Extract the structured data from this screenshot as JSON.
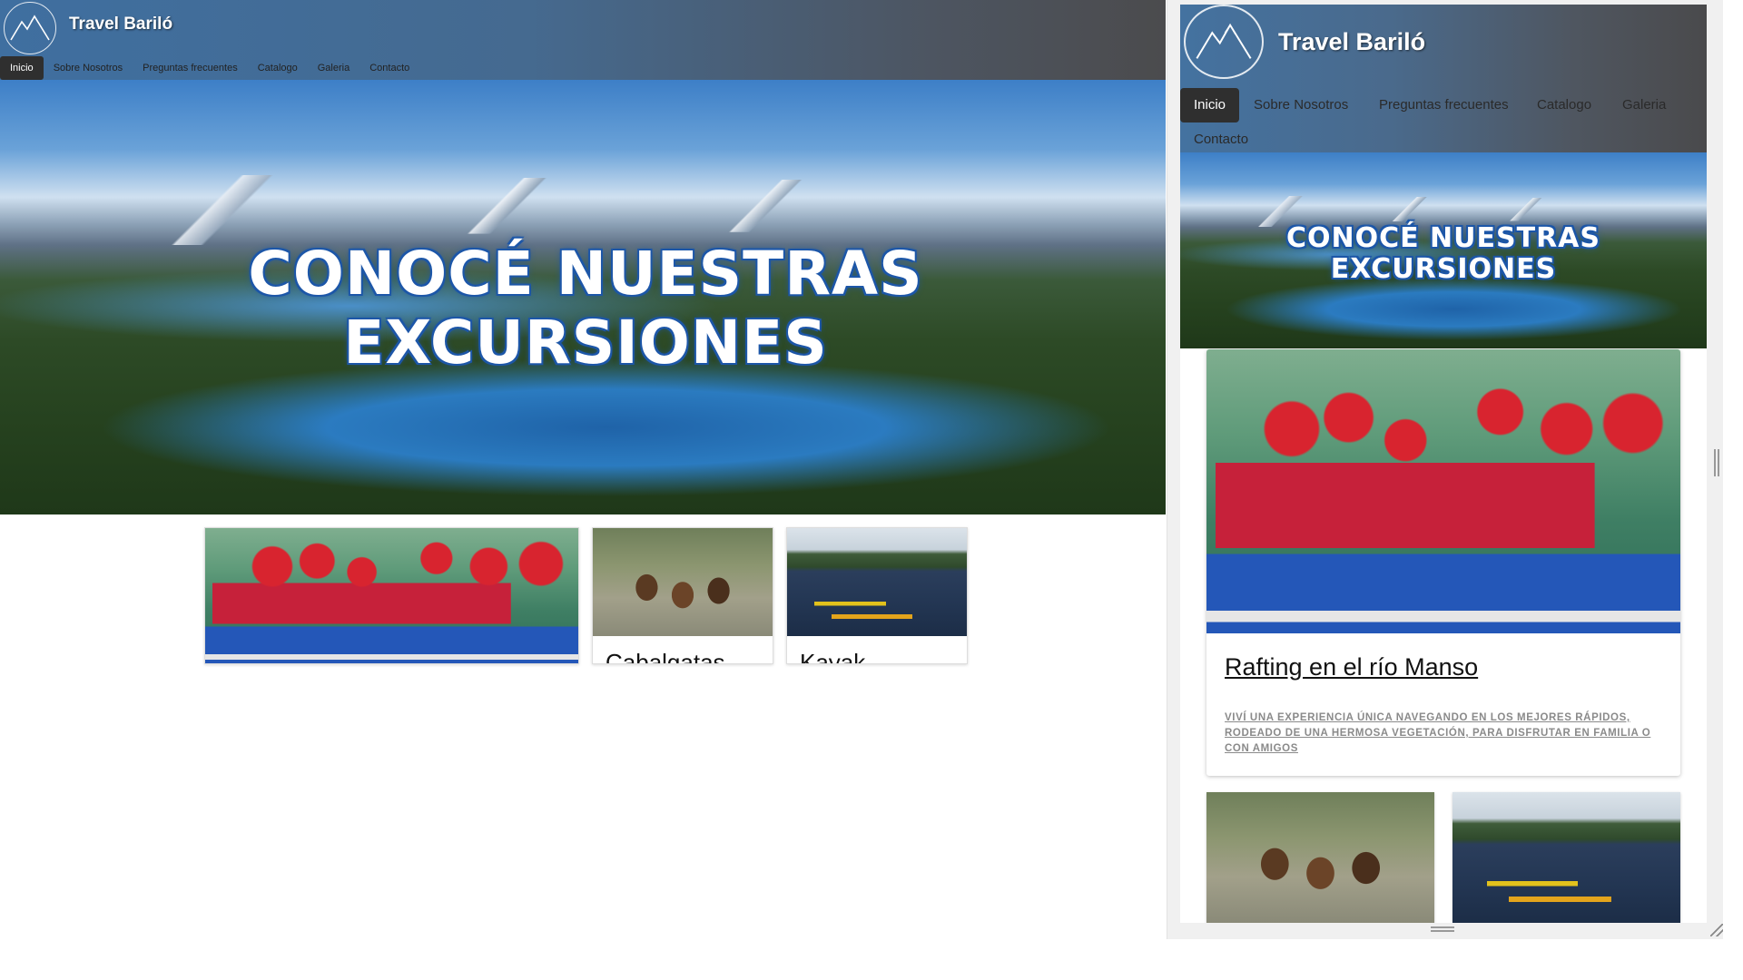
{
  "brand": {
    "name": "Travel Bariló",
    "logo_icon": "mountain-logo-icon"
  },
  "nav": {
    "items": [
      {
        "label": "Inicio",
        "active": true
      },
      {
        "label": "Sobre Nosotros",
        "active": false
      },
      {
        "label": "Preguntas frecuentes",
        "active": false
      },
      {
        "label": "Catalogo",
        "active": false
      },
      {
        "label": "Galeria",
        "active": false
      },
      {
        "label": "Contacto",
        "active": false
      }
    ]
  },
  "hero": {
    "title_line1": "CONOCÉ NUESTRAS",
    "title_line2": "EXCURSIONES"
  },
  "excursions": [
    {
      "title": "Rafting en el río Manso",
      "description": "Viví una experiencia única navegando en los mejores rápidos, rodeado de una hermosa vegetación, para disfrutar en familia o con amigos"
    },
    {
      "title": "Cabalgatas"
    },
    {
      "title": "Kayak"
    }
  ],
  "colors": {
    "nav_blue": "#3f6fa0",
    "nav_gray": "#4b4b4d",
    "active_tab": "#2f2f2f",
    "hero_text_outline": "#1d57a8"
  }
}
